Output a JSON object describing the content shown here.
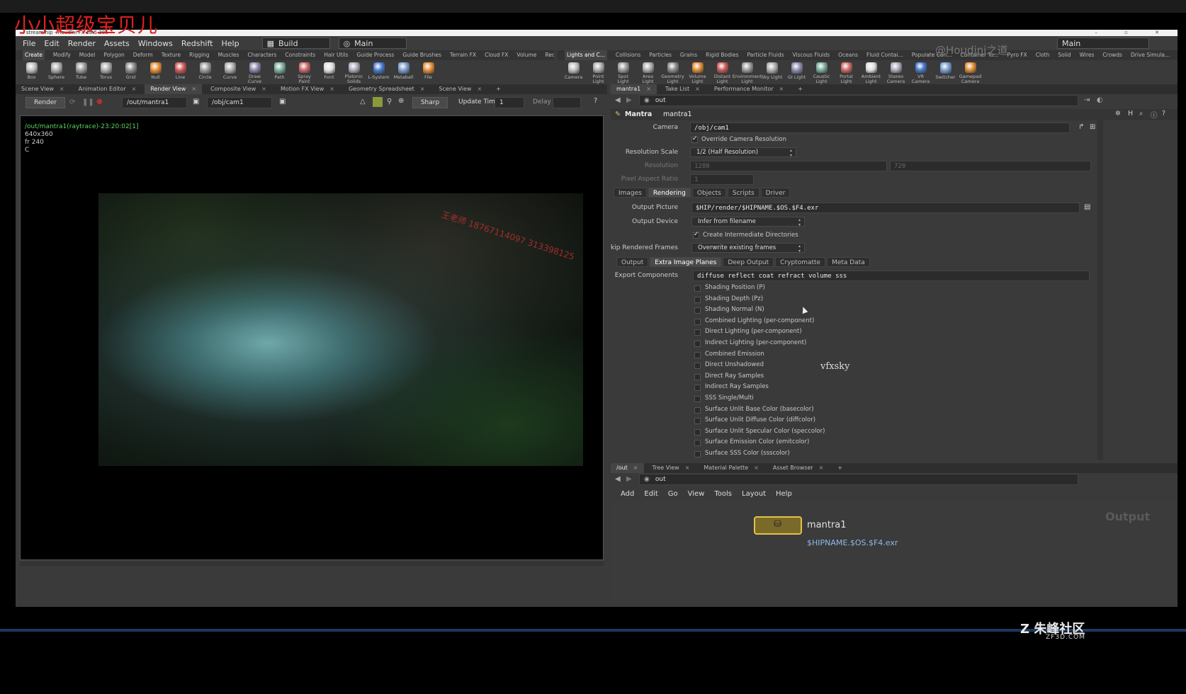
{
  "overlay_title": "小小超级宝贝儿",
  "window": {
    "title": "... stream.hip - Houdini FX 16.5.386"
  },
  "menu": [
    "File",
    "Edit",
    "Render",
    "Assets",
    "Windows",
    "Redshift",
    "Help"
  ],
  "desktop": {
    "build": "Build",
    "main": "Main",
    "main_right": "Main"
  },
  "shelf_tabs_left": [
    "Create",
    "Modify",
    "Model",
    "Polygon",
    "Deform",
    "Texture",
    "Rigging",
    "Muscles",
    "Characters",
    "Constraints",
    "Hair Utils",
    "Guide Process",
    "Guide Brushes",
    "Terrain FX",
    "Cloud FX",
    "Volume",
    "Redshift"
  ],
  "shelf_tabs_right": [
    "Lights and C...",
    "Collisions",
    "Particles",
    "Grains",
    "Rigid Bodies",
    "Particle Fluids",
    "Viscous Fluids",
    "Oceans",
    "Fluid Contai...",
    "Populate Con...",
    "Container To...",
    "Pyro FX",
    "Cloth",
    "Solid",
    "Wires",
    "Crowds",
    "Drive Simula..."
  ],
  "tools_left": [
    "Box",
    "Sphere",
    "Tube",
    "Torus",
    "Grid",
    "Null",
    "Line",
    "Circle",
    "Curve",
    "Draw Curve",
    "Path",
    "Spray Paint",
    "Font",
    "Platonic Solids",
    "L-System",
    "Metaball",
    "File"
  ],
  "tools_right": [
    "Camera",
    "Point Light",
    "Spot Light",
    "Area Light",
    "Geometry Light",
    "Volume Light",
    "Distant Light",
    "Environment Light",
    "Sky Light",
    "GI Light",
    "Caustic Light",
    "Portal Light",
    "Ambient Light",
    "Stereo Camera",
    "VR Camera",
    "Switcher",
    "Gamepad Camera"
  ],
  "left_tabs": [
    "Scene View",
    "Animation Editor",
    "Render View",
    "Composite View",
    "Motion FX View",
    "Geometry Spreadsheet",
    "Scene View"
  ],
  "render_view": {
    "render_label": "Render",
    "rop_path": "/out/mantra1",
    "camera_path": "/obj/cam1",
    "sharp": "Sharp",
    "update_time_label": "Update Time",
    "update_time_value": "1",
    "delay_label": "Delay",
    "info_path": "/out/mantra1(raytrace)-23:20:02[1]",
    "info_res": "640x360",
    "info_frame": "fr 240",
    "info_c": "C",
    "watermark": "王老师 18767114097 313398125"
  },
  "right_tabs": [
    "mantra1",
    "Take List",
    "Performance Monitor"
  ],
  "param_path": "out",
  "param_header": {
    "type": "Mantra",
    "name": "mantra1"
  },
  "params": {
    "camera_label": "Camera",
    "camera_value": "/obj/cam1",
    "override_label": "Override Camera Resolution",
    "res_scale_label": "Resolution Scale",
    "res_scale_value": "1/2 (Half Resolution)",
    "resolution_label": "Resolution",
    "res_x": "1280",
    "res_y": "720",
    "pixel_aspect_label": "Pixel Aspect Ratio",
    "pixel_aspect_value": "1",
    "main_tabs": [
      "Images",
      "Rendering",
      "Objects",
      "Scripts",
      "Driver"
    ],
    "output_picture_label": "Output Picture",
    "output_picture_value": "$HIP/render/$HIPNAME.$OS.$F4.exr",
    "output_device_label": "Output Device",
    "output_device_value": "Infer from filename",
    "create_dirs_label": "Create Intermediate Directories",
    "skip_label": "Skip Rendered Frames",
    "skip_value": "Overwrite existing frames",
    "sub_tabs": [
      "Output",
      "Extra Image Planes",
      "Deep Output",
      "Cryptomatte",
      "Meta Data"
    ],
    "export_label": "Export Components",
    "export_value": "diffuse reflect coat refract volume sss",
    "planes": [
      "Shading Position (P)",
      "Shading Depth (Pz)",
      "Shading Normal (N)",
      "Combined Lighting (per-component)",
      "Direct Lighting (per-component)",
      "Indirect Lighting (per-component)",
      "Combined Emission",
      "Direct Unshadowed",
      "Direct Ray Samples",
      "Indirect Ray Samples",
      "SSS Single/Multi",
      "Surface Unlit Base Color (basecolor)",
      "Surface Unlit Diffuse Color (diffcolor)",
      "Surface Unlit Specular Color (speccolor)",
      "Surface Emission Color (emitcolor)",
      "Surface SSS Color (ssscolor)"
    ]
  },
  "vfxsky": "vfxsky",
  "weibo": "@Houdini之道",
  "net_tabs": [
    "/out",
    "Tree View",
    "Material Palette",
    "Asset Browser"
  ],
  "net_path": "out",
  "net_menu": [
    "Add",
    "Edit",
    "Go",
    "View",
    "Tools",
    "Layout",
    "Help"
  ],
  "node": {
    "name": "mantra1",
    "output": "$HIPNAME.$OS.$F4.exr",
    "flag": "Output"
  },
  "brand": {
    "name": "朱峰社区",
    "site": "ZF3D.COM"
  }
}
